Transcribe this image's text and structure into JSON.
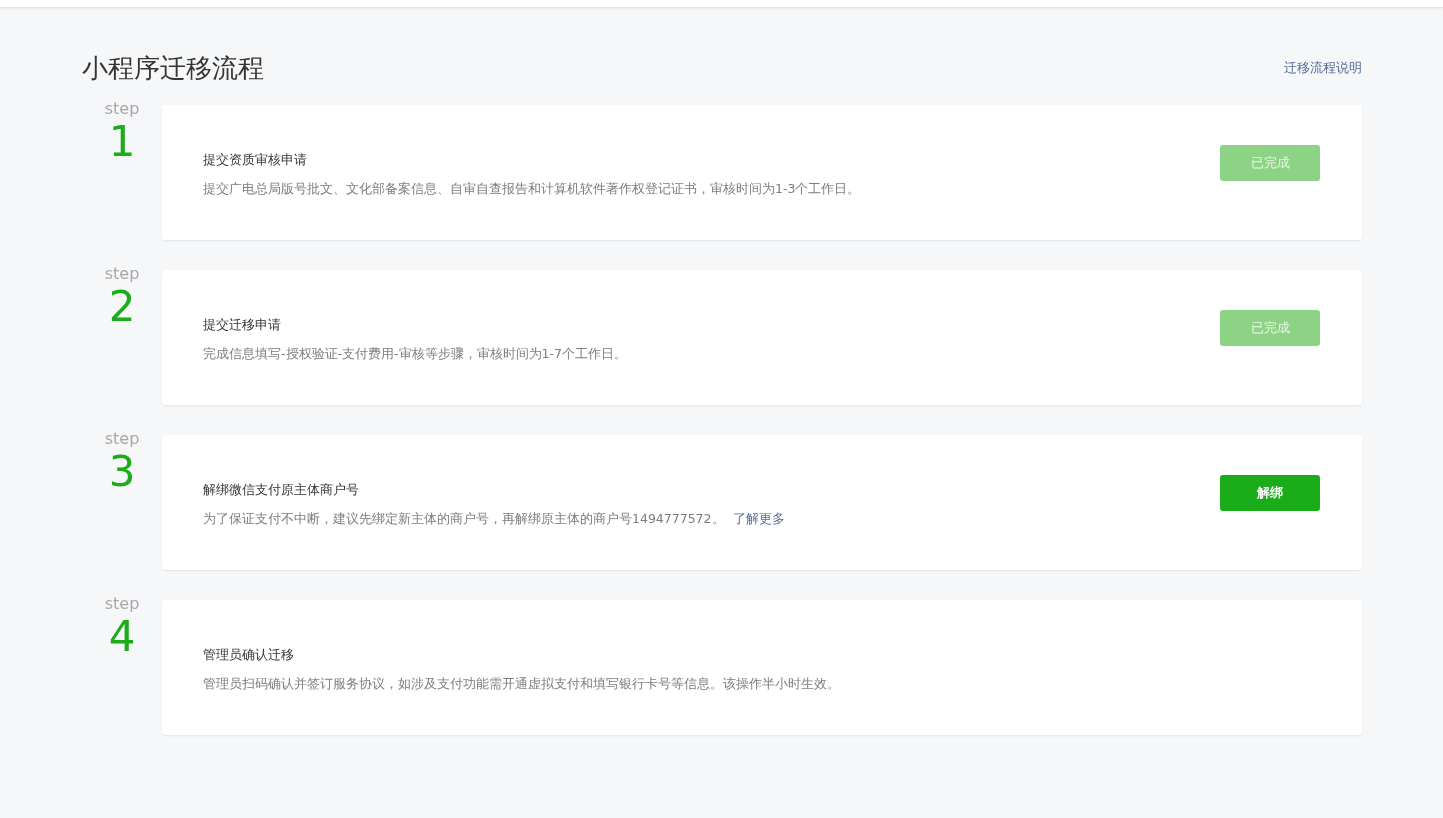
{
  "page": {
    "title": "小程序迁移流程",
    "help_link": "迁移流程说明"
  },
  "steps": [
    {
      "label": "step",
      "number": "1",
      "title": "提交资质审核申请",
      "description": "提交广电总局版号批文、文化部备案信息、自审自查报告和计算机软件著作权登记证书，审核时间为1-3个工作日。",
      "button": {
        "label": "已完成",
        "disabled": true
      }
    },
    {
      "label": "step",
      "number": "2",
      "title": "提交迁移申请",
      "description": "完成信息填写-授权验证-支付费用-审核等步骤，审核时间为1-7个工作日。",
      "button": {
        "label": "已完成",
        "disabled": true
      }
    },
    {
      "label": "step",
      "number": "3",
      "title": "解绑微信支付原主体商户号",
      "description": "为了保证支付不中断，建议先绑定新主体的商户号，再解绑原主体的商户号1494777572。",
      "link": "了解更多",
      "button": {
        "label": "解绑",
        "disabled": false
      }
    },
    {
      "label": "step",
      "number": "4",
      "title": "管理员确认迁移",
      "description": "管理员扫码确认并签订服务协议，如涉及支付功能需开通虚拟支付和填写银行卡号等信息。该操作半小时生效。"
    }
  ]
}
